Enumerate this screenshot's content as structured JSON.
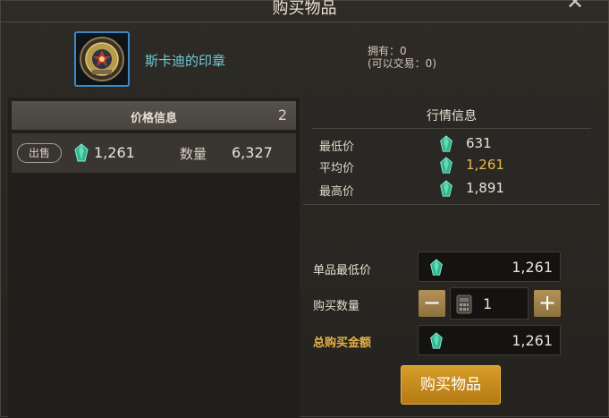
{
  "dialog": {
    "title": "购买物品",
    "close_icon": "close-icon"
  },
  "item": {
    "icon": "seal-emblem-icon",
    "name": "斯卡迪的印章",
    "owned_line": "拥有：0",
    "tradable_line": "(可以交易：0)"
  },
  "price_info": {
    "header": "价格信息",
    "count": "2",
    "listing": {
      "type_badge": "出售",
      "price": "1,261",
      "qty_label": "数量",
      "qty": "6,327"
    }
  },
  "market_info": {
    "title": "行情信息",
    "rows": [
      {
        "label": "最低价",
        "value": "631",
        "color": "#ffffff"
      },
      {
        "label": "平均价",
        "value": "1,261",
        "color": "#e8b84e"
      },
      {
        "label": "最高价",
        "value": "1,891",
        "color": "#ffffff"
      }
    ]
  },
  "purchase_form": {
    "unit_price_label": "单品最低价",
    "unit_price": "1,261",
    "quantity_label": "购买数量",
    "quantity": "1",
    "minus_label": "−",
    "plus_label": "+",
    "total_label": "总购买金额",
    "total": "1,261",
    "buy_button": "购买物品"
  },
  "colors": {
    "currency_gem": "#3fd4b0",
    "accent_gold": "#d59d29",
    "item_name": "#6fcbd7"
  }
}
